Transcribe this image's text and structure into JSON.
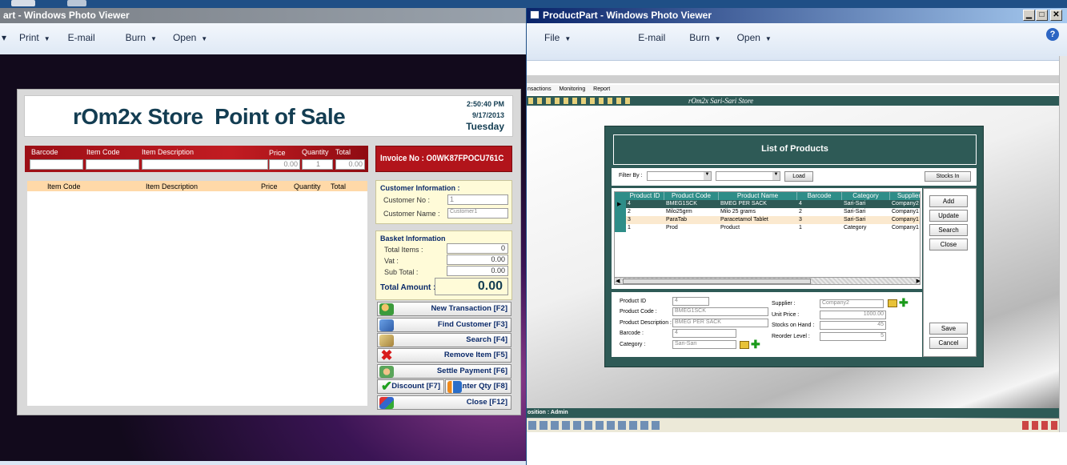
{
  "left_window": {
    "title": "art - Windows Photo Viewer",
    "menu": {
      "print": "Print",
      "email": "E-mail",
      "burn": "Burn",
      "open": "Open"
    }
  },
  "pos": {
    "title": "rOm2x Store  Point of Sale",
    "time": "2:50:40 PM",
    "date": "9/17/2013",
    "day": "Tuesday",
    "entry_labels": {
      "barcode": "Barcode",
      "item_code": "Item Code",
      "item_description": "Item Description",
      "price": "Price",
      "quantity": "Quantity",
      "total": "Total"
    },
    "entry_values": {
      "price": "0.00",
      "quantity": "1",
      "total": "0.00"
    },
    "invoice": "Invoice No : O0WK87FPOCU761C",
    "columns": [
      "Item Code",
      "Item Description",
      "Price",
      "Quantity",
      "Total"
    ],
    "customer": {
      "heading": "Customer Information :",
      "no_label": "Customer No :",
      "no_value": "1",
      "name_label": "Customer Name :",
      "name_value": "Customer1"
    },
    "basket": {
      "heading": "Basket Information",
      "items_label": "Total Items :",
      "items_value": "0",
      "vat_label": "Vat :",
      "vat_value": "0.00",
      "subtotal_label": "Sub Total :",
      "subtotal_value": "0.00",
      "amount_label": "Total Amount :",
      "amount_value": "0.00"
    },
    "buttons": {
      "new": "New Transaction [F2]",
      "find": "Find Customer [F3]",
      "search": "Search [F4]",
      "remove": "Remove Item [F5]",
      "settle": "Settle Payment [F6]",
      "discount": "Discount [F7]",
      "enter_qty": "Enter Qty [F8]",
      "close": "Close [F12]"
    }
  },
  "right_window": {
    "title": "ProductPart - Windows Photo Viewer",
    "menu": {
      "file": "File",
      "email": "E-mail",
      "burn": "Burn",
      "open": "Open"
    },
    "app_menu": [
      "nsactions",
      "Monitoring",
      "Report"
    ],
    "store_title": "rOm2x Sari-Sari Store",
    "status": "osition : Admin"
  },
  "products": {
    "title": "List of Products",
    "filter_label": "Filter By :",
    "load": "Load",
    "stocks_in": "Stocks In",
    "columns": [
      "Product ID",
      "Product Code",
      "Product Name",
      "Barcode",
      "Category",
      "Supplier"
    ],
    "rows": [
      [
        "4",
        "BMEG1SCK",
        "BMEG PER SACK",
        "4",
        "Sari-Sari",
        "Company2"
      ],
      [
        "2",
        "Milo25grm",
        "Milo 25 grams",
        "2",
        "Sari-Sari",
        "Company1"
      ],
      [
        "3",
        "ParaTab",
        "Paracetamol Tablet",
        "3",
        "Sari-Sari",
        "Company1"
      ],
      [
        "1",
        "Prod",
        "Product",
        "1",
        "Category",
        "Company1"
      ]
    ],
    "side_buttons": {
      "add": "Add",
      "update": "Update",
      "search": "Search",
      "close": "Close",
      "save": "Save",
      "cancel": "Cancel"
    },
    "form": {
      "id_label": "Product ID",
      "id_value": "4",
      "code_label": "Product Code :",
      "code_value": "BMEG1SCK",
      "desc_label": "Product Description :",
      "desc_value": "BMEG PER SACK",
      "barcode_label": "Barcode :",
      "barcode_value": "4",
      "category_label": "Category :",
      "category_value": "Sari-Sari",
      "supplier_label": "Supplier :",
      "supplier_value": "Company2",
      "price_label": "Unit Price :",
      "price_value": "1000.00",
      "stocks_label": "Stocks on Hand :",
      "stocks_value": "45",
      "reorder_label": "Reorder Level :",
      "reorder_value": "5"
    }
  },
  "colors": {
    "pos_red": "#b2141b",
    "teal": "#2e5a56",
    "beige": "#fffbd8",
    "peach": "#ffd9a8"
  }
}
